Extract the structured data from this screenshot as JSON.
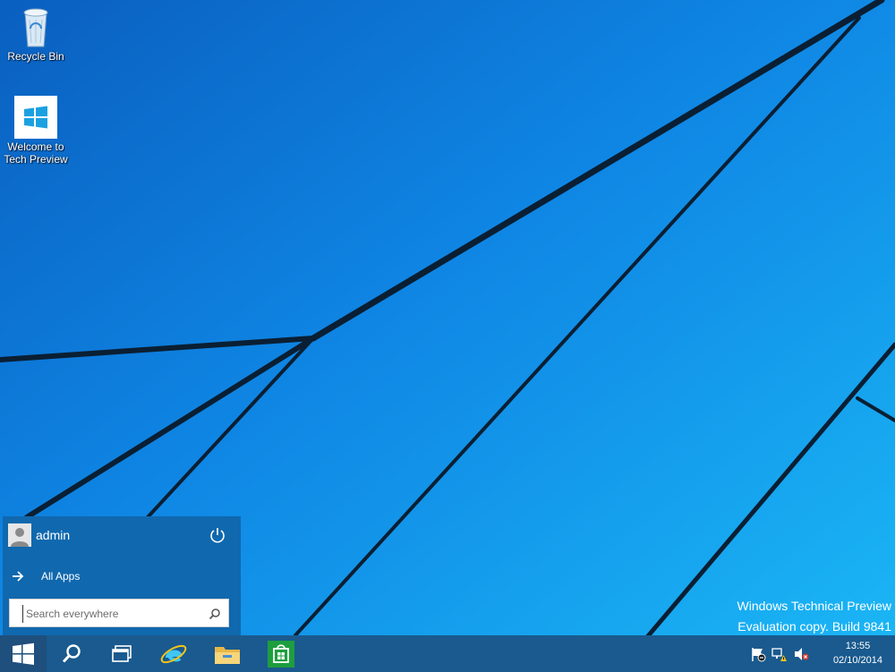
{
  "desktop": {
    "icons": [
      {
        "label_line1": "Recycle Bin",
        "label_line2": "",
        "icon": "recycle-bin-icon"
      },
      {
        "label_line1": "Welcome to",
        "label_line2": "Tech Preview",
        "icon": "windows-logo-icon"
      }
    ],
    "watermark": {
      "line1": "Windows Technical Preview",
      "line2": "Evaluation copy. Build 9841"
    }
  },
  "start_menu": {
    "user_name": "admin",
    "all_apps_label": "All Apps",
    "search_placeholder": "Search everywhere",
    "search_value": ""
  },
  "taskbar": {
    "buttons": [
      "start-button",
      "search-button",
      "task-view-button",
      "internet-explorer-button",
      "file-explorer-button",
      "store-button"
    ],
    "clock": {
      "time": "13:55",
      "date": "02/10/2014"
    }
  },
  "colors": {
    "start_menu_bg": "#1068ae",
    "taskbar_bg": "#1a5a8e",
    "store_green": "#1e9e3e",
    "accent_blue": "#12a0ef"
  }
}
